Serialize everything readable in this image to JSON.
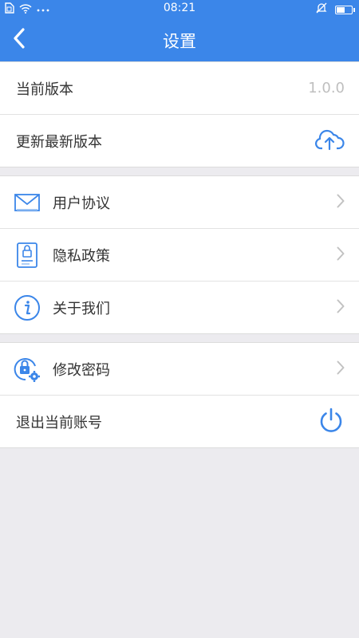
{
  "status_bar": {
    "time": "08:21",
    "left_icons": [
      "sim-icon",
      "wifi-icon",
      "more-dots-icon"
    ],
    "right_icons": [
      "mute-bell-icon",
      "battery-icon"
    ],
    "battery_level_pct": 55
  },
  "header": {
    "title": "设置",
    "background": "#3b86e9"
  },
  "groups": [
    {
      "rows": [
        {
          "label": "当前版本",
          "value": "1.0.0"
        },
        {
          "label": "更新最新版本",
          "icon": "cloud-upload-icon"
        }
      ]
    },
    {
      "rows": [
        {
          "label": "用户协议",
          "icon": "envelope-icon"
        },
        {
          "label": "隐私政策",
          "icon": "lock-document-icon"
        },
        {
          "label": "关于我们",
          "icon": "info-icon"
        }
      ]
    },
    {
      "rows": [
        {
          "label": "修改密码",
          "icon": "lock-gear-icon"
        },
        {
          "label": "退出当前账号",
          "icon": "power-icon"
        }
      ]
    }
  ],
  "accent_color": "#3b86e9"
}
